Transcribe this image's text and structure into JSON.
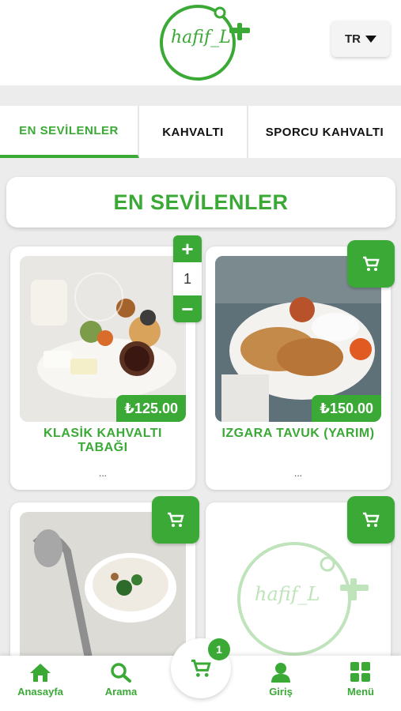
{
  "header": {
    "logo_text": "hafif_L",
    "language": "TR"
  },
  "tabs": [
    {
      "label": "EN SEVİLENLER",
      "active": true
    },
    {
      "label": "KAHVALTI",
      "active": false
    },
    {
      "label": "SPORCU KAHVALTI",
      "active": false
    }
  ],
  "section": {
    "title": "EN SEVİLENLER"
  },
  "products": [
    {
      "name": "KLASİK KAHVALTI TABAĞI",
      "price": "₺125.00",
      "description": "...",
      "quantity": "1",
      "image": "breakfast-plate"
    },
    {
      "name": "IZGARA TAVUK (YARIM)",
      "price": "₺150.00",
      "description": "...",
      "image": "grilled-chicken"
    },
    {
      "name": "",
      "price": "",
      "description": "",
      "image": "yogurt-soup"
    },
    {
      "name": "",
      "price": "",
      "description": "",
      "image": "placeholder-logo"
    }
  ],
  "stepper": {
    "plus": "+",
    "minus": "−",
    "quantity": "1"
  },
  "cart": {
    "count": "1"
  },
  "bottom_nav": [
    {
      "label": "Anasayfa",
      "icon": "home-icon"
    },
    {
      "label": "Arama",
      "icon": "search-icon"
    },
    {
      "label": "Giriş",
      "icon": "user-icon"
    },
    {
      "label": "Menü",
      "icon": "grid-icon"
    }
  ],
  "colors": {
    "brand_green": "#3aa936",
    "background": "#ececec"
  }
}
